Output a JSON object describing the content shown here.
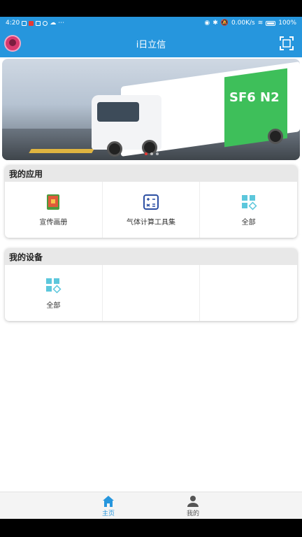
{
  "status_bar": {
    "time": "4:20",
    "network_speed": "0.00K/s",
    "battery": "100%"
  },
  "app_bar": {
    "title": "i日立信",
    "avatar_icon": "avatar-icon",
    "scan_icon": "scan-icon"
  },
  "banner": {
    "trailer_text": "SF6 N2",
    "slides_count": 3,
    "active_slide": 1
  },
  "my_apps": {
    "title": "我的应用",
    "items": [
      {
        "label": "宣传画册",
        "icon": "brochure-icon"
      },
      {
        "label": "气体计算工具集",
        "icon": "calculator-icon"
      },
      {
        "label": "全部",
        "icon": "all-apps-icon"
      }
    ]
  },
  "my_devices": {
    "title": "我的设备",
    "items": [
      {
        "label": "全部",
        "icon": "all-apps-icon"
      }
    ]
  },
  "tab_bar": {
    "tabs": [
      {
        "label": "主页",
        "icon": "home-icon",
        "active": true
      },
      {
        "label": "我的",
        "icon": "person-icon",
        "active": false
      }
    ]
  },
  "colors": {
    "primary": "#2696dd",
    "card_header": "#e8e8e8",
    "icon_cyan": "#5cc7dc",
    "icon_blue": "#2c4fa3"
  }
}
